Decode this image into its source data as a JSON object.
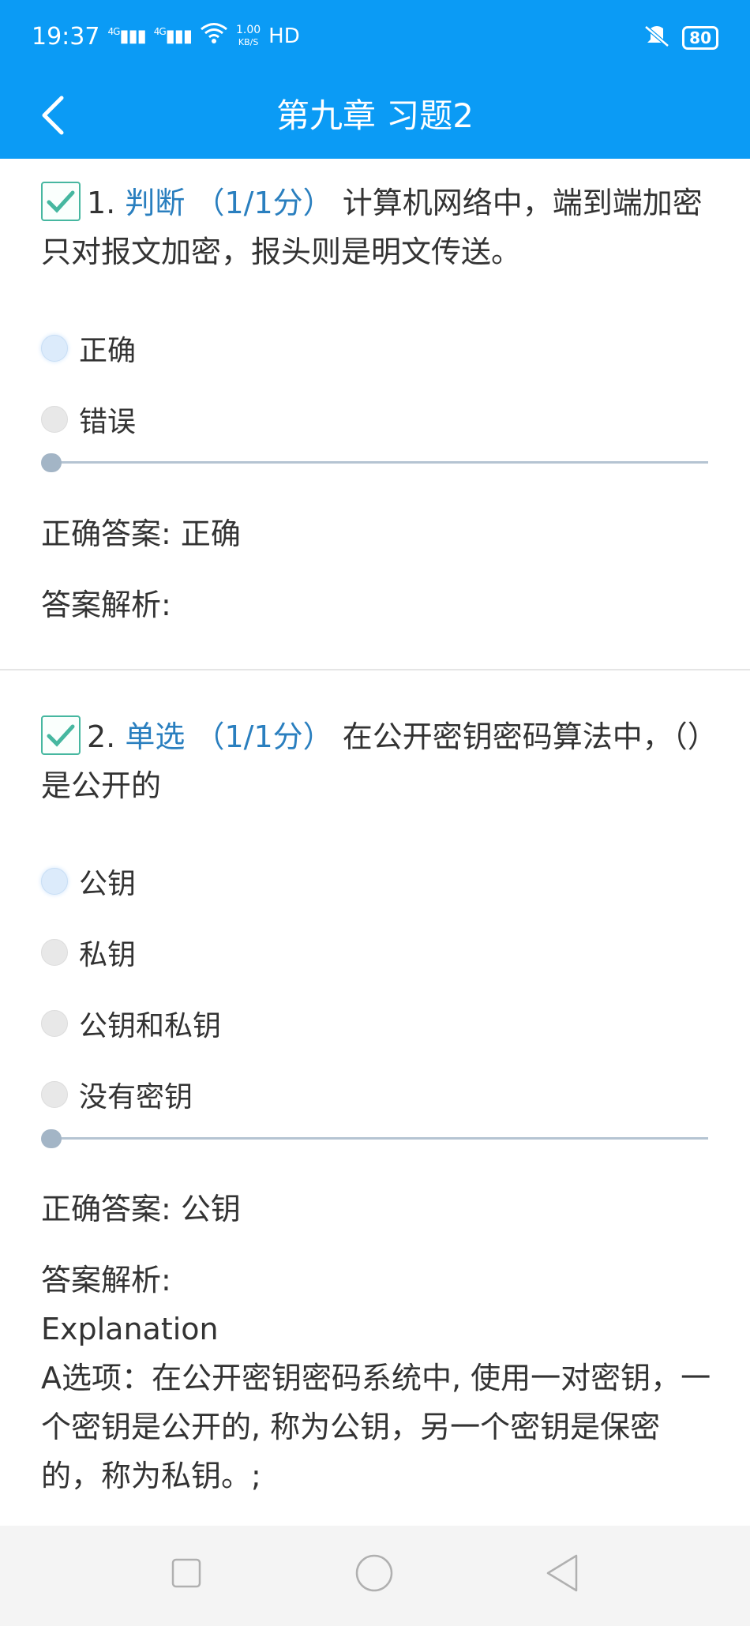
{
  "status_bar": {
    "time": "19:37",
    "signal1": "4G",
    "signal2": "4G",
    "net_speed": "1.00",
    "net_unit": "KB/S",
    "hd_label": "HD",
    "battery": "80"
  },
  "header": {
    "title": "第九章 习题2"
  },
  "questions": [
    {
      "number": "1.",
      "type": "判断",
      "score": "（1/1分）",
      "text": "计算机网络中，端到端加密只对报文加密，报头则是明文传送。",
      "options": [
        {
          "label": "正确",
          "selected": true
        },
        {
          "label": "错误",
          "selected": false
        }
      ],
      "correct_answer_label": "正确答案:",
      "correct_answer": "正确",
      "analysis_label": "答案解析:"
    },
    {
      "number": "2.",
      "type": "单选",
      "score": "（1/1分）",
      "text": "在公开密钥密码算法中，（）是公开的",
      "options": [
        {
          "label": "公钥",
          "selected": true
        },
        {
          "label": "私钥",
          "selected": false
        },
        {
          "label": "公钥和私钥",
          "selected": false
        },
        {
          "label": "没有密钥",
          "selected": false
        }
      ],
      "correct_answer_label": "正确答案:",
      "correct_answer": "公钥",
      "analysis_label": "答案解析:",
      "explanation_title": "Explanation",
      "explanation_text": "A选项：在公开密钥密码系统中, 使用一对密钥，一个密钥是公开的, 称为公钥，另一个密钥是保密的，称为私钥。;"
    }
  ],
  "colors": {
    "header_bg": "#0b9bf5",
    "accent_type": "#2a7fbf",
    "check_green": "#46b7a0"
  },
  "icons": {
    "back": "chevron-left-icon",
    "check": "check-icon",
    "nav_recent": "square-icon",
    "nav_home": "circle-icon",
    "nav_back": "triangle-left-icon"
  }
}
